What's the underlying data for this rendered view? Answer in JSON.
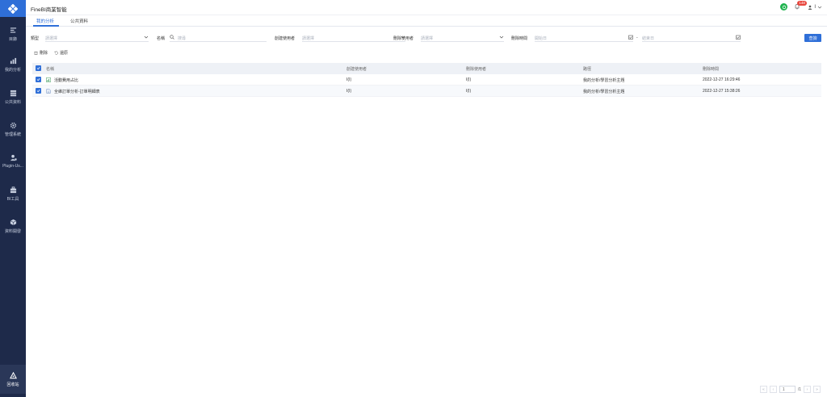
{
  "app": {
    "title": "FineBI商業智能"
  },
  "sidebar": {
    "items": [
      {
        "label": "目錄",
        "icon": "list-icon"
      },
      {
        "label": "我的分析",
        "icon": "chart-icon"
      },
      {
        "label": "公共資料",
        "icon": "database-icon"
      },
      {
        "label": "管理系統",
        "icon": "gear-icon"
      },
      {
        "label": "Plugin-Us...",
        "icon": "user-plugin-icon"
      },
      {
        "label": "BI工具",
        "icon": "toolbox-icon"
      },
      {
        "label": "資料開發",
        "icon": "cube-icon"
      }
    ],
    "bottom": {
      "label": "回收站",
      "icon": "recycle-icon"
    }
  },
  "header": {
    "badge_count": "148",
    "user_name": "I"
  },
  "tabs": [
    {
      "label": "我的分析"
    },
    {
      "label": "公共資料"
    }
  ],
  "filters": {
    "type_label": "類型",
    "type_placeholder": "請選擇",
    "name_label": "名稱",
    "name_placeholder": "搜尋",
    "creator_label": "創建使用者",
    "creator_placeholder": "請選擇",
    "deleter_label": "刪除使用者",
    "deleter_placeholder": "請選擇",
    "time_label": "刪除時間",
    "start_placeholder": "開始日",
    "end_placeholder": "結束日",
    "query_label": "查詢"
  },
  "actions": {
    "delete_label": "刪除",
    "restore_label": "還原"
  },
  "table": {
    "headers": [
      "名稱",
      "創建使用者",
      "刪除使用者",
      "路徑",
      "刪除時間"
    ],
    "rows": [
      {
        "name": "活動費用占比",
        "creator": "I(I)",
        "deleter": "I(I)",
        "path": "我的分析/學習分析主題",
        "time": "2022-12-27 16:29:46"
      },
      {
        "name": "全維訂單分析-訂單明細表",
        "creator": "I(I)",
        "deleter": "I(I)",
        "path": "我的分析/學習分析主題",
        "time": "2022-12-27 15:38:26"
      }
    ]
  },
  "pager": {
    "page": "1",
    "total": "/1"
  },
  "colors": {
    "sidebar": "#1e2a4a",
    "accent": "#2f6fd8",
    "status": "#1fb34e",
    "badge": "#e8453c"
  }
}
